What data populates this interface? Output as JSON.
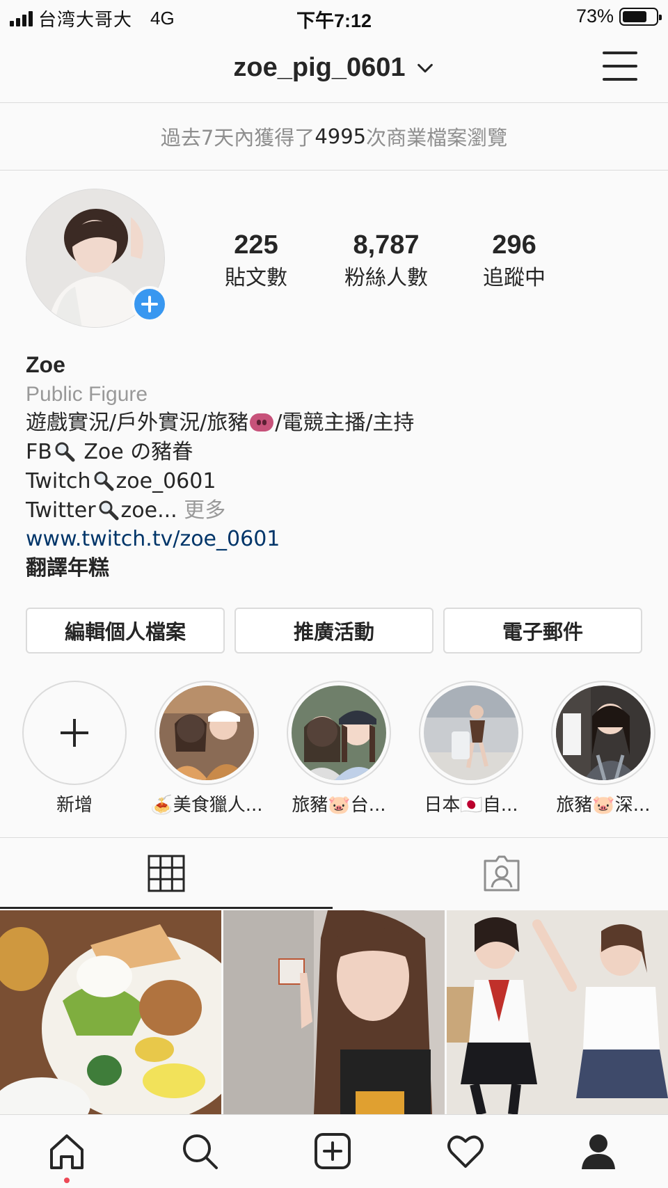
{
  "status_bar": {
    "carrier": "台湾大哥大",
    "network": "4G",
    "time": "下午7:12",
    "battery": "73%",
    "battery_level": 0.73
  },
  "header": {
    "username": "zoe_pig_0601",
    "icons": [
      "chevron-down-icon",
      "menu-icon"
    ]
  },
  "insights": {
    "prefix": "過去7天內獲得了",
    "count": "4995",
    "suffix": "次商業檔案瀏覽"
  },
  "stats": [
    {
      "value": "225",
      "label": "貼文數"
    },
    {
      "value": "8,787",
      "label": "粉絲人數"
    },
    {
      "value": "296",
      "label": "追蹤中"
    }
  ],
  "bio": {
    "name": "Zoe",
    "category": "Public Figure",
    "line1_a": "遊戲實況/戶外實況/旅豬",
    "line1_b": "/電競主播/主持",
    "line2_a": "FB",
    "line2_b": " Zoe の豬眷",
    "line3_a": "Twitch",
    "line3_b": "zoe_0601",
    "line4_a": "Twitter",
    "line4_b": "zoe...",
    "more": " 更多",
    "link": "www.twitch.tv/zoe_0601",
    "translate": "翻譯年糕"
  },
  "buttons": {
    "edit_profile": "編輯個人檔案",
    "promotions": "推廣活動",
    "email": "電子郵件"
  },
  "highlights": [
    {
      "label": "新增"
    },
    {
      "label": "🍝美食獵人..."
    },
    {
      "label": "旅豬🐷台..."
    },
    {
      "label": "日本🇯🇵自..."
    },
    {
      "label": "旅豬🐷深..."
    }
  ],
  "tabs": [
    "grid-icon",
    "tagged-icon"
  ],
  "colors": {
    "accent": "#3897f0",
    "link": "#003569",
    "notification": "#ed4956"
  },
  "bottom_nav": [
    "home-icon",
    "search-icon",
    "new-post-icon",
    "activity-heart-icon",
    "profile-icon"
  ]
}
